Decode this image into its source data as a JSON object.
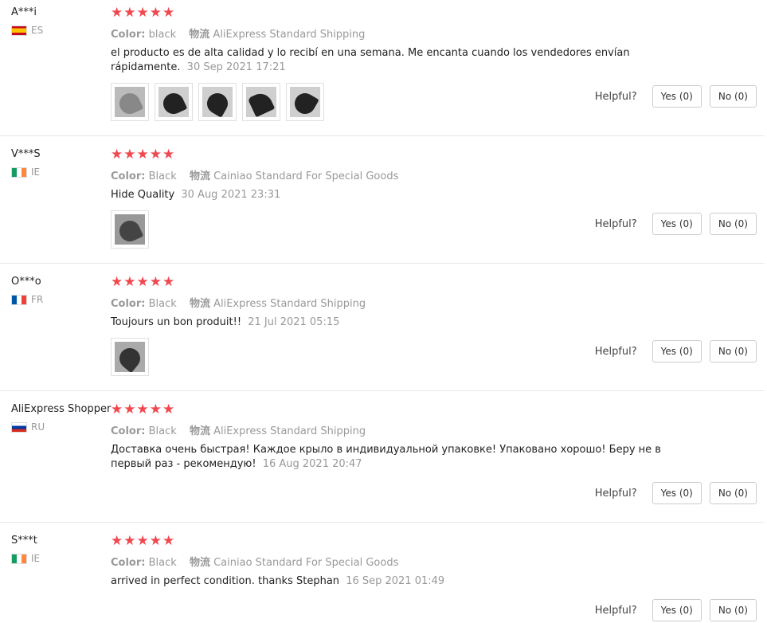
{
  "helpful_label": "Helpful?",
  "star_color": "#f0484f",
  "reviews": [
    {
      "user": "A***i",
      "country": "ES",
      "flag": "spain-flag-icon",
      "rating": 5,
      "color_label": "Color:",
      "color": "black",
      "ship_label": "物流",
      "shipping": "AliExpress Standard Shipping",
      "text": "el producto es de alta calidad y lo recibí en una semana. Me encanta cuando los vendedores envían rápidamente.",
      "date": "30 Sep 2021 17:21",
      "photos": 5,
      "yes": "Yes (0)",
      "no": "No (0)"
    },
    {
      "user": "V***S",
      "country": "IE",
      "flag": "ireland-flag-icon",
      "rating": 5,
      "color_label": "Color:",
      "color": "Black",
      "ship_label": "物流",
      "shipping": "Cainiao Standard For Special Goods",
      "text": "Hide Quality",
      "date": "30 Aug 2021 23:31",
      "photos": 1,
      "yes": "Yes (0)",
      "no": "No (0)"
    },
    {
      "user": "O***o",
      "country": "FR",
      "flag": "france-flag-icon",
      "rating": 5,
      "color_label": "Color:",
      "color": "Black",
      "ship_label": "物流",
      "shipping": "AliExpress Standard Shipping",
      "text": "Toujours un bon produit!!",
      "date": "21 Jul 2021 05:15",
      "photos": 1,
      "yes": "Yes (0)",
      "no": "No (0)"
    },
    {
      "user": "AliExpress Shopper",
      "country": "RU",
      "flag": "russia-flag-icon",
      "rating": 5,
      "color_label": "Color:",
      "color": "Black",
      "ship_label": "物流",
      "shipping": "AliExpress Standard Shipping",
      "text": "Доставка очень быстрая! Каждое крыло в индивидуальной упаковке! Упаковано хорошо! Беру не в первый раз - рекомендую!",
      "date": "16 Aug 2021 20:47",
      "photos": 0,
      "yes": "Yes (0)",
      "no": "No (0)"
    },
    {
      "user": "S***t",
      "country": "IE",
      "flag": "ireland-flag-icon",
      "rating": 5,
      "color_label": "Color:",
      "color": "Black",
      "ship_label": "物流",
      "shipping": "Cainiao Standard For Special Goods",
      "text": "arrived in perfect condition. thanks Stephan",
      "date": "16 Sep 2021 01:49",
      "photos": 0,
      "yes": "Yes (0)",
      "no": "No (0)"
    }
  ]
}
